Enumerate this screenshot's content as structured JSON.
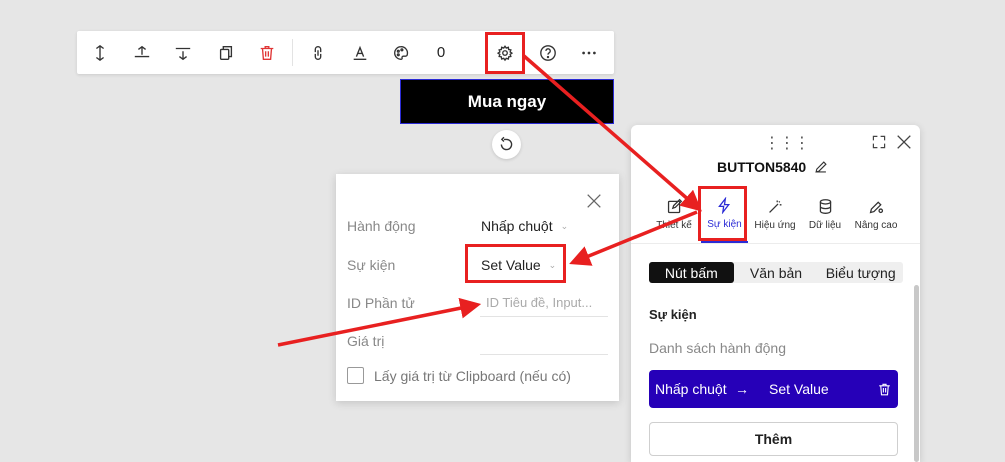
{
  "toolbar": {
    "items": [
      "move-vertical-icon",
      "align-top-icon",
      "align-bottom-icon",
      "copy-icon",
      "trash-icon",
      "link-icon",
      "text-format-icon",
      "palette-icon",
      "counter",
      "gear-icon",
      "help-icon",
      "more-icon"
    ],
    "count": "0"
  },
  "canvas": {
    "button_label": "Mua ngay"
  },
  "popup": {
    "rows": [
      {
        "label": "Hành động",
        "value": "Nhấp chuột"
      },
      {
        "label": "Sự kiện",
        "value": "Set Value"
      },
      {
        "label": "ID Phần tử",
        "placeholder": "ID Tiêu đề, Input..."
      },
      {
        "label": "Giá trị",
        "placeholder": ""
      }
    ],
    "clipboard_label": "Lấy giá trị từ Clipboard (nếu có)"
  },
  "panel": {
    "title": "BUTTON5840",
    "tabs": [
      {
        "label": "Thiết kế"
      },
      {
        "label": "Sự kiện"
      },
      {
        "label": "Hiệu ứng"
      },
      {
        "label": "Dữ liệu"
      },
      {
        "label": "Nâng cao"
      }
    ],
    "segments": [
      "Nút bấm",
      "Văn bản",
      "Biểu tượng"
    ],
    "section_title": "Sự kiện",
    "section_subtitle": "Danh sách hành động",
    "action": {
      "trigger": "Nhấp chuột",
      "arrow": "→",
      "event": "Set Value"
    },
    "add_label": "Thêm"
  },
  "colors": {
    "accent": "#2b2bd6",
    "action_bg": "#2600b8",
    "annotation": "#e82020"
  }
}
